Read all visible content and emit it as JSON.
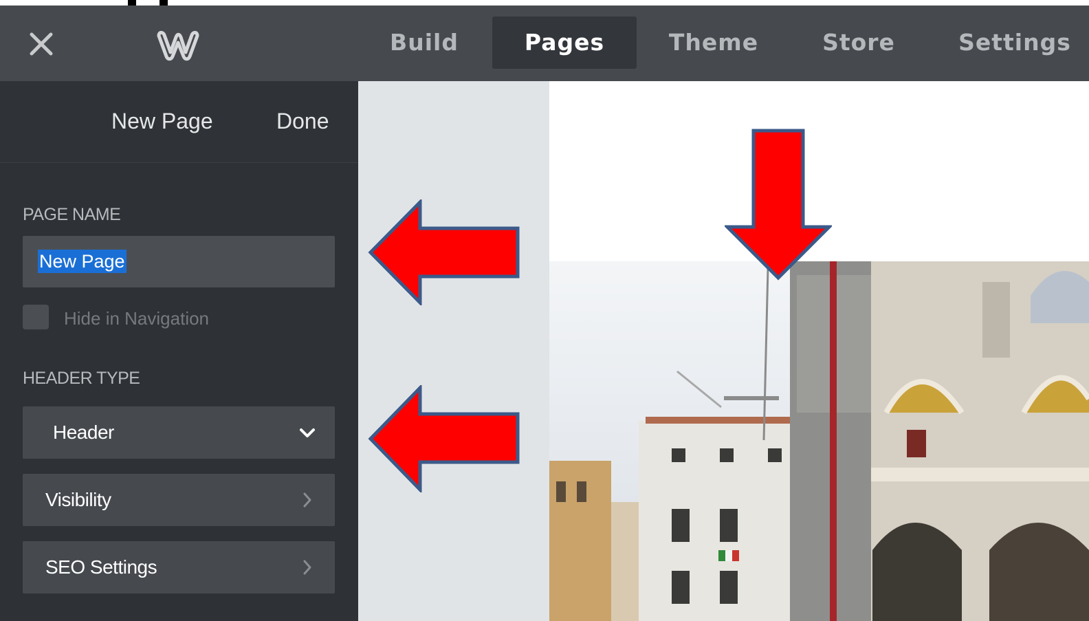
{
  "topbar": {
    "close_icon": "close-icon",
    "logo_icon": "weebly-logo",
    "tabs": [
      {
        "label": "Build",
        "active": false
      },
      {
        "label": "Pages",
        "active": true
      },
      {
        "label": "Theme",
        "active": false
      },
      {
        "label": "Store",
        "active": false
      },
      {
        "label": "Settings",
        "active": false
      }
    ]
  },
  "sidebar": {
    "title": "New Page",
    "done_label": "Done",
    "page_name_label": "PAGE NAME",
    "page_name_value": "New Page",
    "hide_nav_label": "Hide in Navigation",
    "hide_nav_checked": false,
    "header_type_label": "HEADER TYPE",
    "header_type_value": "Header",
    "rows": [
      {
        "label": "Visibility",
        "icon": "chevron-right-icon"
      },
      {
        "label": "SEO Settings",
        "icon": "chevron-right-icon"
      }
    ]
  },
  "annotations": {
    "arrow_color": "#ff0000",
    "arrow_outline": "#3b5a8a"
  },
  "colors": {
    "topbar_bg": "#464a4f",
    "active_tab_bg": "#33373b",
    "sidebar_bg": "#2e3236",
    "selection": "#1a6fd6"
  }
}
